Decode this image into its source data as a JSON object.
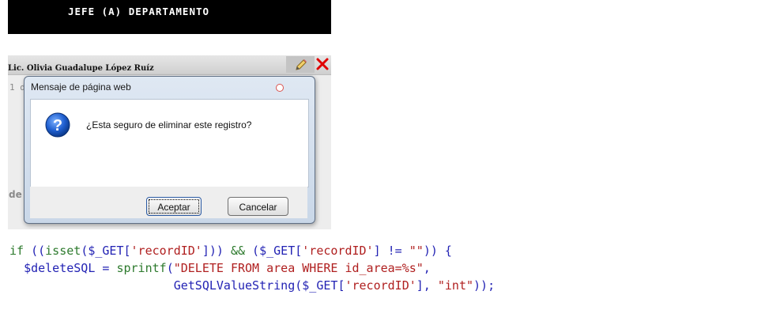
{
  "header": {
    "title": "JEFE (A) DEPARTAMENTO"
  },
  "panel": {
    "name": "Lic. Olivia Guadalupe López Ruíz",
    "line1": "1 d",
    "line2": "de"
  },
  "dialog": {
    "title": "Mensaje de página web",
    "message": "¿Esta seguro de eliminar este registro?",
    "accept_label": "Aceptar",
    "cancel_label": "Cancelar"
  },
  "code": {
    "line1": {
      "kw_if": "if",
      "p1": " ((",
      "fn_isset": "isset",
      "p2": "(",
      "var_get1": "$_GET",
      "p3": "[",
      "str_rec1": "'recordID'",
      "p4": "])) ",
      "op_and": "&&",
      "p5": " (",
      "var_get2": "$_GET",
      "p6": "[",
      "str_rec2": "'recordID'",
      "p7": "] != ",
      "str_empty": "\"\"",
      "p8": ")) {"
    },
    "line2": {
      "indent": "  ",
      "var_sql": "$deleteSQL",
      "p1": " = ",
      "fn_sprintf": "sprintf",
      "p2": "(",
      "str_sql": "\"DELETE FROM area WHERE id_area=%s\"",
      "p3": ","
    },
    "line3": {
      "indent": "                       ",
      "fn_get": "GetSQLValueString",
      "p1": "(",
      "var_get": "$_GET",
      "p2": "[",
      "str_rec": "'recordID'",
      "p3": "], ",
      "str_int": "\"int\"",
      "p4": "));"
    }
  },
  "colors": {
    "header_bg": "#000000",
    "code_keyword": "#2d7a2d",
    "code_string": "#b02020",
    "code_default": "#2323b4",
    "delete_icon": "#e00000"
  },
  "icons": {
    "edit": "pencil-icon",
    "delete": "delete-x-icon",
    "dialog_close": "close-icon",
    "question": "question-icon"
  }
}
